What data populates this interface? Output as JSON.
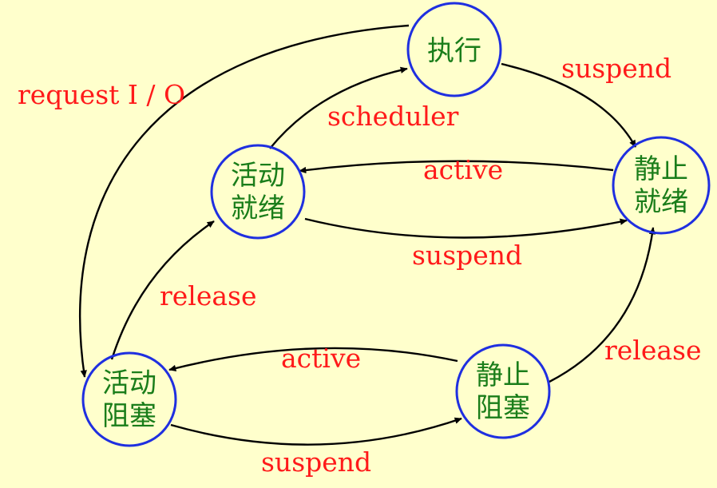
{
  "states": {
    "exec": {
      "line1": "执行",
      "line2": ""
    },
    "active_ready": {
      "line1": "活动",
      "line2": "就绪"
    },
    "static_ready": {
      "line1": "静止",
      "line2": "就绪"
    },
    "active_blocked": {
      "line1": "活动",
      "line2": "阻塞"
    },
    "static_blocked": {
      "line1": "静止",
      "line2": "阻塞"
    }
  },
  "edges": {
    "request_io": "request I / O",
    "scheduler": "scheduler",
    "suspend_exec": "suspend",
    "active_ready": "active",
    "suspend_ready": "suspend",
    "release_left": "release",
    "active_blocked": "active",
    "release_right": "release",
    "suspend_blocked": "suspend"
  },
  "colors": {
    "background": "#FFFFCC",
    "state_border": "#1f2fe0",
    "state_text": "#1a7d1a",
    "edge_label": "#ff1a1a",
    "edge_line": "#000000"
  }
}
